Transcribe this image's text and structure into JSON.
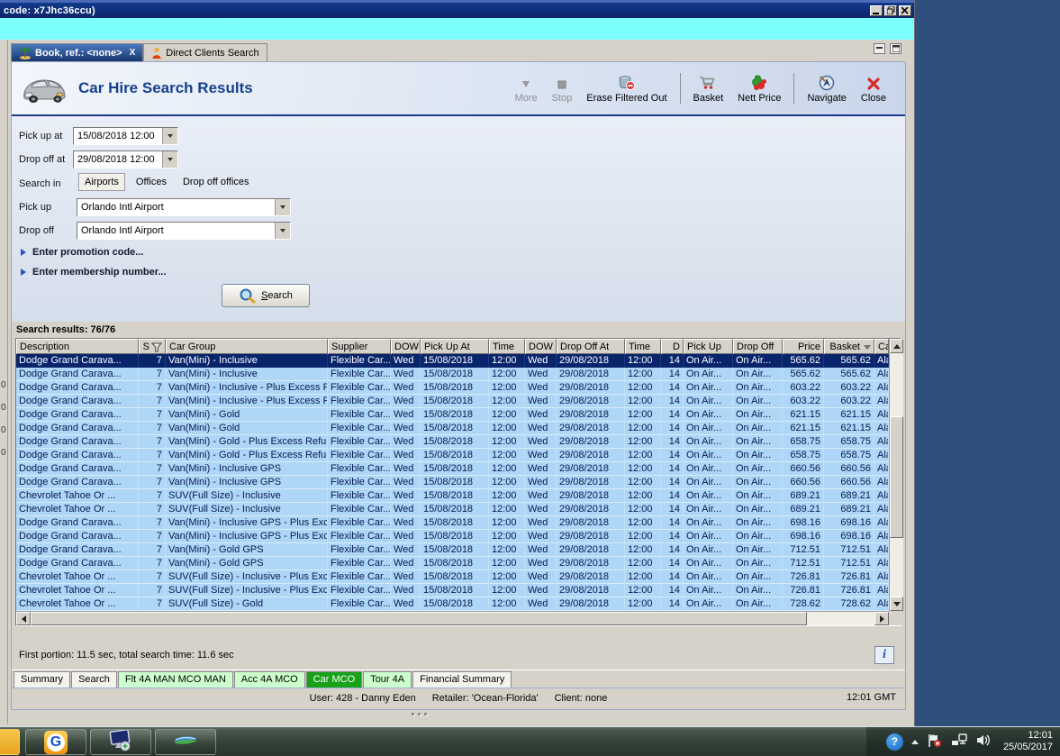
{
  "window": {
    "title": "code: x7Jhc36ccu)",
    "controls": {
      "minimize": "minimize",
      "restore": "restore",
      "close": "close"
    }
  },
  "doc_tabs": {
    "items": [
      {
        "label": "Book, ref.: <none>",
        "icon": "palm-tree",
        "active": true,
        "closable": true
      },
      {
        "label": "Direct Clients Search",
        "icon": "person",
        "active": false,
        "closable": false
      }
    ]
  },
  "header": {
    "title": "Car Hire Search Results"
  },
  "toolbar": {
    "items": [
      {
        "label": "More",
        "icon": "more",
        "disabled": true,
        "sep_after": false
      },
      {
        "label": "Stop",
        "icon": "stop",
        "disabled": true,
        "sep_after": false
      },
      {
        "label": "Erase Filtered Out",
        "icon": "erase",
        "disabled": false,
        "sep_after": true
      },
      {
        "label": "Basket",
        "icon": "basket",
        "disabled": false,
        "sep_after": false
      },
      {
        "label": "Nett Price",
        "icon": "nett-price",
        "disabled": false,
        "sep_after": true
      },
      {
        "label": "Navigate",
        "icon": "navigate",
        "disabled": false,
        "sep_after": false
      },
      {
        "label": "Close",
        "icon": "close",
        "disabled": false,
        "sep_after": false
      }
    ]
  },
  "form": {
    "pickup_at": {
      "label": "Pick up at",
      "value": "15/08/2018 12:00"
    },
    "dropoff_at": {
      "label": "Drop off at",
      "value": "29/08/2018 12:00"
    },
    "search_in": {
      "label": "Search in",
      "options": [
        "Airports",
        "Offices",
        "Drop off offices"
      ],
      "selected": "Airports"
    },
    "pickup_office": {
      "label": "Pick up",
      "value": "Orlando Intl Airport"
    },
    "dropoff_office": {
      "label": "Drop off",
      "value": "Orlando Intl Airport"
    },
    "promotion_link": "Enter promotion code...",
    "membership_link": "Enter membership number...",
    "search_button": "Search"
  },
  "results": {
    "count_label": "Search results: 76/76",
    "columns": [
      "Description",
      "S",
      "Car Group",
      "Supplier",
      "DOW",
      "Pick Up At",
      "Time",
      "DOW",
      "Drop Off At",
      "Time",
      "D",
      "Pick Up",
      "Drop Off",
      "Price",
      "Basket",
      "Ca"
    ],
    "selected_row_index": 0,
    "rows": [
      [
        "Dodge Grand Carava...",
        "7",
        "Van(Mini) - Inclusive",
        "Flexible Car...",
        "Wed",
        "15/08/2018",
        "12:00",
        "Wed",
        "29/08/2018",
        "12:00",
        "14",
        "On Air...",
        "On Air...",
        "565.62",
        "565.62",
        "Ala"
      ],
      [
        "Dodge Grand Carava...",
        "7",
        "Van(Mini) - Inclusive",
        "Flexible Car...",
        "Wed",
        "15/08/2018",
        "12:00",
        "Wed",
        "29/08/2018",
        "12:00",
        "14",
        "On Air...",
        "On Air...",
        "565.62",
        "565.62",
        "Ala"
      ],
      [
        "Dodge Grand Carava...",
        "7",
        "Van(Mini) - Inclusive - Plus Excess Ref...",
        "Flexible Car...",
        "Wed",
        "15/08/2018",
        "12:00",
        "Wed",
        "29/08/2018",
        "12:00",
        "14",
        "On Air...",
        "On Air...",
        "603.22",
        "603.22",
        "Ala"
      ],
      [
        "Dodge Grand Carava...",
        "7",
        "Van(Mini) - Inclusive - Plus Excess Ref...",
        "Flexible Car...",
        "Wed",
        "15/08/2018",
        "12:00",
        "Wed",
        "29/08/2018",
        "12:00",
        "14",
        "On Air...",
        "On Air...",
        "603.22",
        "603.22",
        "Ala"
      ],
      [
        "Dodge Grand Carava...",
        "7",
        "Van(Mini) - Gold",
        "Flexible Car...",
        "Wed",
        "15/08/2018",
        "12:00",
        "Wed",
        "29/08/2018",
        "12:00",
        "14",
        "On Air...",
        "On Air...",
        "621.15",
        "621.15",
        "Ala"
      ],
      [
        "Dodge Grand Carava...",
        "7",
        "Van(Mini) - Gold",
        "Flexible Car...",
        "Wed",
        "15/08/2018",
        "12:00",
        "Wed",
        "29/08/2018",
        "12:00",
        "14",
        "On Air...",
        "On Air...",
        "621.15",
        "621.15",
        "Ala"
      ],
      [
        "Dodge Grand Carava...",
        "7",
        "Van(Mini) - Gold - Plus Excess Refund",
        "Flexible Car...",
        "Wed",
        "15/08/2018",
        "12:00",
        "Wed",
        "29/08/2018",
        "12:00",
        "14",
        "On Air...",
        "On Air...",
        "658.75",
        "658.75",
        "Ala"
      ],
      [
        "Dodge Grand Carava...",
        "7",
        "Van(Mini) - Gold - Plus Excess Refund",
        "Flexible Car...",
        "Wed",
        "15/08/2018",
        "12:00",
        "Wed",
        "29/08/2018",
        "12:00",
        "14",
        "On Air...",
        "On Air...",
        "658.75",
        "658.75",
        "Ala"
      ],
      [
        "Dodge Grand Carava...",
        "7",
        "Van(Mini) - Inclusive GPS",
        "Flexible Car...",
        "Wed",
        "15/08/2018",
        "12:00",
        "Wed",
        "29/08/2018",
        "12:00",
        "14",
        "On Air...",
        "On Air...",
        "660.56",
        "660.56",
        "Ala"
      ],
      [
        "Dodge Grand Carava...",
        "7",
        "Van(Mini) - Inclusive GPS",
        "Flexible Car...",
        "Wed",
        "15/08/2018",
        "12:00",
        "Wed",
        "29/08/2018",
        "12:00",
        "14",
        "On Air...",
        "On Air...",
        "660.56",
        "660.56",
        "Ala"
      ],
      [
        "Chevrolet Tahoe Or ...",
        "7",
        "SUV(Full Size) - Inclusive",
        "Flexible Car...",
        "Wed",
        "15/08/2018",
        "12:00",
        "Wed",
        "29/08/2018",
        "12:00",
        "14",
        "On Air...",
        "On Air...",
        "689.21",
        "689.21",
        "Ala"
      ],
      [
        "Chevrolet Tahoe Or ...",
        "7",
        "SUV(Full Size) - Inclusive",
        "Flexible Car...",
        "Wed",
        "15/08/2018",
        "12:00",
        "Wed",
        "29/08/2018",
        "12:00",
        "14",
        "On Air...",
        "On Air...",
        "689.21",
        "689.21",
        "Ala"
      ],
      [
        "Dodge Grand Carava...",
        "7",
        "Van(Mini) - Inclusive GPS - Plus Exces...",
        "Flexible Car...",
        "Wed",
        "15/08/2018",
        "12:00",
        "Wed",
        "29/08/2018",
        "12:00",
        "14",
        "On Air...",
        "On Air...",
        "698.16",
        "698.16",
        "Ala"
      ],
      [
        "Dodge Grand Carava...",
        "7",
        "Van(Mini) - Inclusive GPS - Plus Exces...",
        "Flexible Car...",
        "Wed",
        "15/08/2018",
        "12:00",
        "Wed",
        "29/08/2018",
        "12:00",
        "14",
        "On Air...",
        "On Air...",
        "698.16",
        "698.16",
        "Ala"
      ],
      [
        "Dodge Grand Carava...",
        "7",
        "Van(Mini) - Gold GPS",
        "Flexible Car...",
        "Wed",
        "15/08/2018",
        "12:00",
        "Wed",
        "29/08/2018",
        "12:00",
        "14",
        "On Air...",
        "On Air...",
        "712.51",
        "712.51",
        "Ala"
      ],
      [
        "Dodge Grand Carava...",
        "7",
        "Van(Mini) - Gold GPS",
        "Flexible Car...",
        "Wed",
        "15/08/2018",
        "12:00",
        "Wed",
        "29/08/2018",
        "12:00",
        "14",
        "On Air...",
        "On Air...",
        "712.51",
        "712.51",
        "Ala"
      ],
      [
        "Chevrolet Tahoe Or ...",
        "7",
        "SUV(Full Size) - Inclusive - Plus Excess...",
        "Flexible Car...",
        "Wed",
        "15/08/2018",
        "12:00",
        "Wed",
        "29/08/2018",
        "12:00",
        "14",
        "On Air...",
        "On Air...",
        "726.81",
        "726.81",
        "Ala"
      ],
      [
        "Chevrolet Tahoe Or ...",
        "7",
        "SUV(Full Size) - Inclusive - Plus Excess...",
        "Flexible Car...",
        "Wed",
        "15/08/2018",
        "12:00",
        "Wed",
        "29/08/2018",
        "12:00",
        "14",
        "On Air...",
        "On Air...",
        "726.81",
        "726.81",
        "Ala"
      ],
      [
        "Chevrolet Tahoe Or ...",
        "7",
        "SUV(Full Size) - Gold",
        "Flexible Car...",
        "Wed",
        "15/08/2018",
        "12:00",
        "Wed",
        "29/08/2018",
        "12:00",
        "14",
        "On Air...",
        "On Air...",
        "728.62",
        "728.62",
        "Ala"
      ]
    ],
    "timing_note": "First portion: 11.5 sec, total search time: 11.6 sec"
  },
  "page_tabs": {
    "items": [
      {
        "label": "Summary",
        "style": "plain"
      },
      {
        "label": "Search",
        "style": "plain"
      },
      {
        "label": "Flt 4A MAN MCO MAN",
        "style": "green-light"
      },
      {
        "label": "Acc 4A MCO",
        "style": "green-light"
      },
      {
        "label": "Car MCO",
        "style": "green-selected"
      },
      {
        "label": "Tour 4A",
        "style": "green-light"
      },
      {
        "label": "Financial Summary",
        "style": "plain"
      }
    ]
  },
  "status_bar": {
    "user": "User: 428 - Danny Eden",
    "retailer": "Retailer: 'Ocean-Florida'",
    "client": "Client: none",
    "time": "12:01 GMT"
  },
  "taskbar": {
    "clock_time": "12:01",
    "clock_date": "25/05/2017"
  },
  "edge_fragments": {
    "digits": [
      "0",
      "0",
      "0",
      "0"
    ]
  },
  "colors": {
    "selected_row": "#08246b",
    "row_blue": "#aed6f6",
    "title_blue": "#16418c",
    "tab_green_selected": "#19a119",
    "tab_green_light": "#ccffcc",
    "titlebar": "#0a246a",
    "cyan_strip": "#7dffff"
  }
}
